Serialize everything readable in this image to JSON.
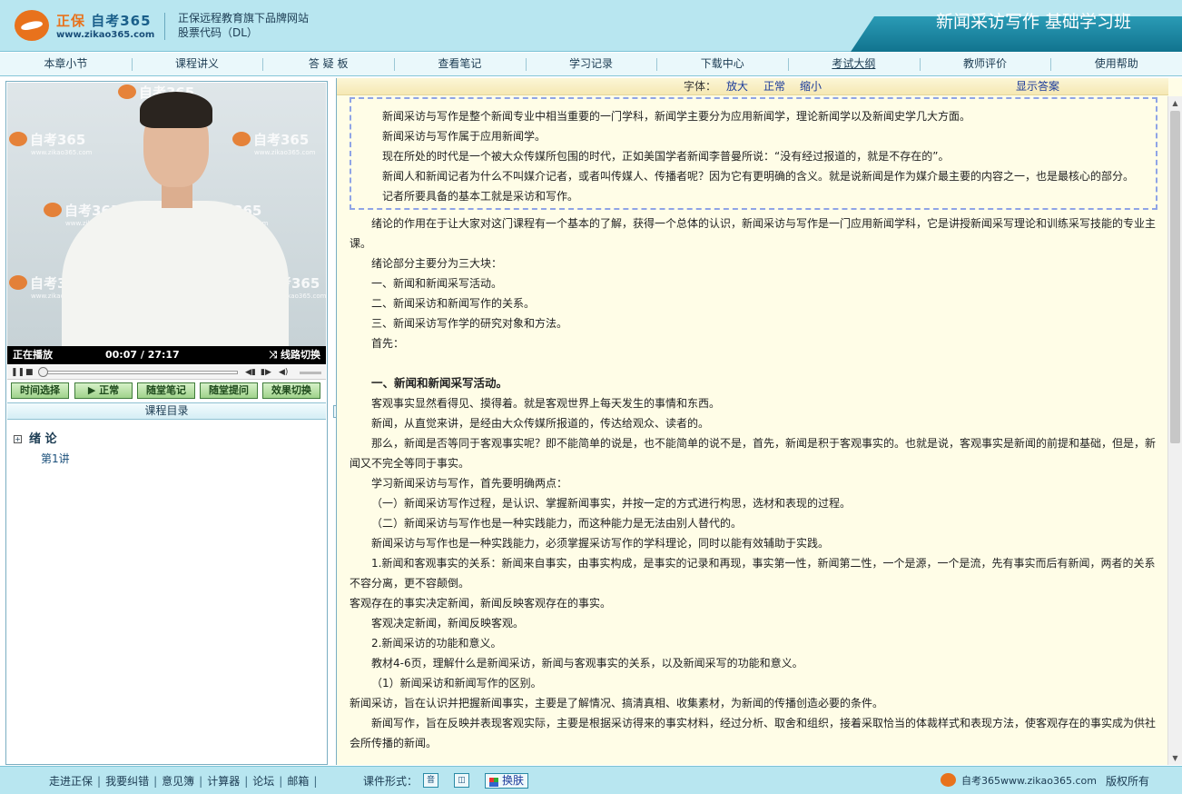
{
  "header": {
    "logo_name_a": "正保",
    "logo_name_b": "自考365",
    "logo_url": "www.zikao365.com",
    "slogan_line1": "正保远程教育旗下品牌网站",
    "slogan_line2": "股票代码（DL）",
    "course_title": "新闻采访写作 基础学习班"
  },
  "nav": [
    "本章小节",
    "课程讲义",
    "答 疑 板",
    "查看笔记",
    "学习记录",
    "下载中心",
    "考试大纲",
    "教师评价",
    "使用帮助"
  ],
  "video": {
    "watermark_text": "自考365",
    "watermark_url": "www.zikao365.com",
    "status": "正在播放",
    "time": "00:07 / 27:17",
    "line_switch": "线路切换",
    "progress_fraction": 0.0043
  },
  "video_buttons": [
    "时间选择",
    "▶ 正常",
    "随堂笔记",
    "随堂提问",
    "效果切换"
  ],
  "toc": {
    "title": "课程目录",
    "chapter": "绪  论",
    "lecture": "第1讲"
  },
  "font_bar": {
    "label": "字体：",
    "enlarge": "放大",
    "normal": "正常",
    "shrink": "缩小",
    "show_answer": "显示答案"
  },
  "summary": [
    "新闻采访与写作是整个新闻专业中相当重要的一门学科，新闻学主要分为应用新闻学，理论新闻学以及新闻史学几大方面。",
    "新闻采访与写作属于应用新闻学。",
    "现在所处的时代是一个被大众传媒所包围的时代，正如美国学者新闻李普曼所说：“没有经过报道的，就是不存在的”。",
    "新闻人和新闻记者为什么不叫媒介记者，或者叫传媒人、传播者呢？因为它有更明确的含义。就是说新闻是作为媒介最主要的内容之一，也是最核心的部分。",
    "记者所要具备的基本工就是采访和写作。"
  ],
  "body": [
    {
      "t": "绪论的作用在于让大家对这门课程有一个基本的了解，获得一个总体的认识，新闻采访与写作是一门应用新闻学科，它是讲授新闻采写理论和训练采写技能的专业主课。",
      "c": ""
    },
    {
      "t": "绪论部分主要分为三大块：",
      "c": ""
    },
    {
      "t": "一、新闻和新闻采写活动。",
      "c": ""
    },
    {
      "t": "二、新闻采访和新闻写作的关系。",
      "c": ""
    },
    {
      "t": "三、新闻采访写作学的研究对象和方法。",
      "c": ""
    },
    {
      "t": "首先：",
      "c": ""
    },
    {
      "t": "",
      "c": "gap"
    },
    {
      "t": "一、新闻和新闻采写活动。",
      "c": "b"
    },
    {
      "t": "客观事实显然看得见、摸得着。就是客观世界上每天发生的事情和东西。",
      "c": ""
    },
    {
      "t": "新闻，从直觉来讲，是经由大众传媒所报道的，传达给观众、读者的。",
      "c": ""
    },
    {
      "t": "那么，新闻是否等同于客观事实呢？即不能简单的说是，也不能简单的说不是，首先，新闻是积于客观事实的。也就是说，客观事实是新闻的前提和基础，但是，新闻又不完全等同于事实。",
      "c": ""
    },
    {
      "t": "学习新闻采访与写作，首先要明确两点：",
      "c": ""
    },
    {
      "t": "（一）新闻采访写作过程，是认识、掌握新闻事实，并按一定的方式进行构思，选材和表现的过程。",
      "c": ""
    },
    {
      "t": "（二）新闻采访与写作也是一种实践能力，而这种能力是无法由别人替代的。",
      "c": ""
    },
    {
      "t": "新闻采访与写作也是一种实践能力，必须掌握采访写作的学科理论，同时以能有效辅助于实践。",
      "c": ""
    },
    {
      "t": "1.新闻和客观事实的关系：新闻来自事实，由事实构成，是事实的记录和再现，事实第一性，新闻第二性，一个是源，一个是流，先有事实而后有新闻，两者的关系不容分离，更不容颠倒。",
      "c": ""
    },
    {
      "t": "客观存在的事实决定新闻，新闻反映客观存在的事实。",
      "c": "noi"
    },
    {
      "t": "客观决定新闻，新闻反映客观。",
      "c": ""
    },
    {
      "t": "2.新闻采访的功能和意义。",
      "c": ""
    },
    {
      "t": "教材4-6页，理解什么是新闻采访，新闻与客观事实的关系，以及新闻采写的功能和意义。",
      "c": ""
    },
    {
      "t": "（1）新闻采访和新闻写作的区别。",
      "c": ""
    },
    {
      "t": "新闻采访，旨在认识并把握新闻事实，主要是了解情况、搞清真相、收集素材，为新闻的传播创造必要的条件。",
      "c": "noi"
    },
    {
      "t": "新闻写作，旨在反映并表现客观实际，主要是根据采访得来的事实材料，经过分析、取舍和组织，接着采取恰当的体裁样式和表现方法，使客观存在的事实成为供社会所传播的新闻。",
      "c": ""
    }
  ],
  "footer": {
    "links": [
      "走进正保",
      "我要纠错",
      "意见簿",
      "计算器",
      "论坛",
      "邮箱"
    ],
    "mode_label": "课件形式：",
    "mode_audio": "音",
    "skin": "换肤",
    "brand": "自考365www.zikao365.com",
    "copyright": "版权所有"
  }
}
